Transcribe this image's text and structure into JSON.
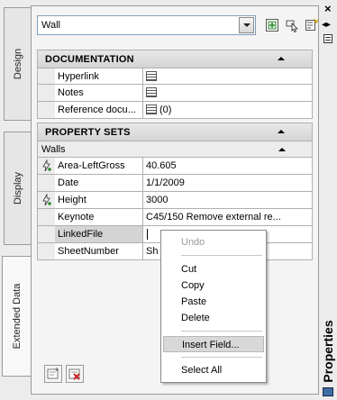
{
  "tabs": [
    {
      "label": "Design"
    },
    {
      "label": "Display"
    },
    {
      "label": "Extended Data"
    }
  ],
  "topbar": {
    "selected_value": "Wall"
  },
  "documentation": {
    "title": "DOCUMENTATION",
    "rows": [
      {
        "name": "Hyperlink",
        "value": ""
      },
      {
        "name": "Notes",
        "value": ""
      },
      {
        "name": "Reference docu...",
        "value": "(0)"
      }
    ]
  },
  "property_sets": {
    "title": "PROPERTY SETS",
    "group": "Walls",
    "rows": [
      {
        "name": "Area-LeftGross",
        "value": "40.605"
      },
      {
        "name": "Date",
        "value": "1/1/2009"
      },
      {
        "name": "Height",
        "value": "3000"
      },
      {
        "name": "Keynote",
        "value": "C45/150 Remove external re..."
      },
      {
        "name": "LinkedFile",
        "value": ""
      },
      {
        "name": "SheetNumber",
        "value": "Sh"
      }
    ]
  },
  "context_menu": {
    "items": [
      {
        "label": "Undo",
        "disabled": true
      },
      {
        "label": "Cut"
      },
      {
        "label": "Copy"
      },
      {
        "label": "Paste"
      },
      {
        "label": "Delete"
      },
      {
        "label": "Insert Field...",
        "highlighted": true
      },
      {
        "label": "Select All"
      }
    ]
  },
  "side": {
    "close": "×",
    "title": "Properties"
  },
  "colors": {
    "ctx_highlight": "#d8d8d8",
    "lightning_green": "#2e8b2e",
    "delete_red": "#cc2222"
  }
}
